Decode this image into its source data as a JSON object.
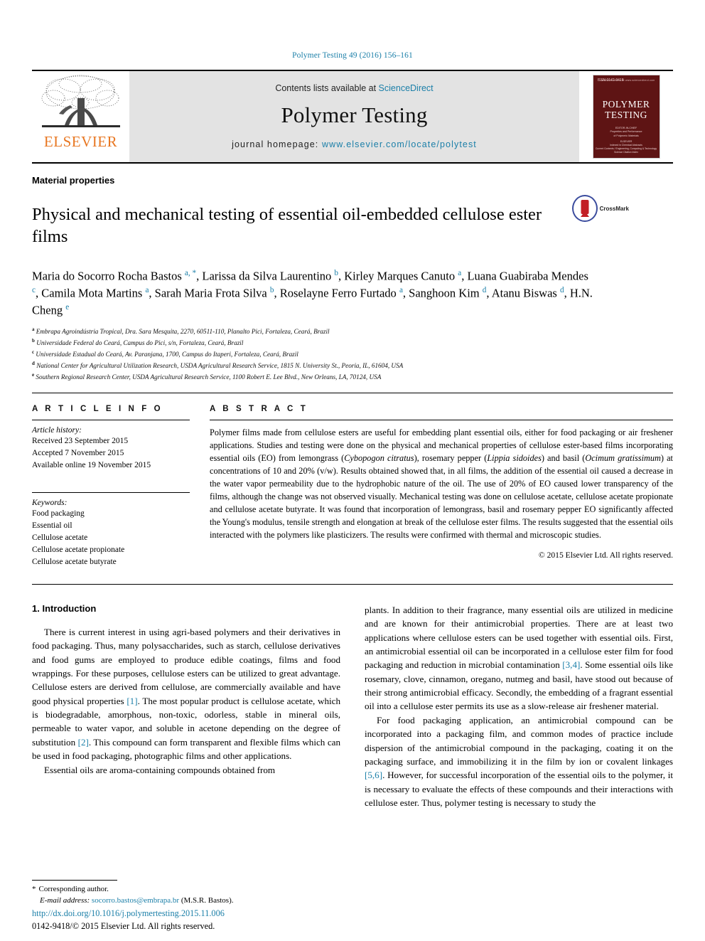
{
  "running_head": "Polymer Testing 49 (2016) 156–161",
  "masthead": {
    "publisher_name": "ELSEVIER",
    "contents_prefix": "Contents lists available at ",
    "contents_link": "ScienceDirect",
    "journal_title": "Polymer Testing",
    "homepage_prefix": "journal homepage: ",
    "homepage_link": "www.elsevier.com/locate/polytest",
    "cover": {
      "top_label": "ISSN 0142-9418",
      "corner_label": "Available online at www.sciencedirect.com",
      "title_line1": "POLYMER",
      "title_line2": "TESTING",
      "sub_lines": "EDITOR-IN-CHIEF\nProperties and Performance\nof Polymeric Materials",
      "foot_lines": "ELSEVIER\nIndexed in Chemical Abstracts\nCurrent Contents / Engineering, Computing & Technology\nScience Citation Index"
    }
  },
  "article": {
    "section_label": "Material properties",
    "title": "Physical and mechanical testing of essential oil-embedded cellulose ester films",
    "crossmark_label": "CrossMark",
    "authors_html": "Maria do Socorro Rocha Bastos <sup class=\"sup-mark\">a, *</sup>, Larissa da Silva Laurentino <sup class=\"sup-mark\">b</sup>, Kirley Marques Canuto <sup class=\"sup-mark\">a</sup>, Luana Guabiraba Mendes <sup class=\"sup-mark\">c</sup>, Camila Mota Martins <sup class=\"sup-mark\">a</sup>, Sarah Maria Frota Silva <sup class=\"sup-mark\">b</sup>, Roselayne Ferro Furtado <sup class=\"sup-mark\">a</sup>, Sanghoon Kim <sup class=\"sup-mark\">d</sup>, Atanu Biswas <sup class=\"sup-mark\">d</sup>, H.N. Cheng <sup class=\"sup-mark\">e</sup>",
    "affiliations": [
      {
        "mark": "a",
        "text": "Embrapa Agroindústria Tropical, Dra. Sara Mesquita, 2270, 60511-110, Planalto Pici, Fortaleza, Ceará, Brazil"
      },
      {
        "mark": "b",
        "text": "Universidade Federal do Ceará, Campus do Pici, s/n, Fortaleza, Ceará, Brazil"
      },
      {
        "mark": "c",
        "text": "Universidade Estadual do Ceará, Av. Paranjana, 1700, Campus do Itaperi, Fortaleza, Ceará, Brazil"
      },
      {
        "mark": "d",
        "text": "National Center for Agricultural Utilization Research, USDA Agricultural Research Service, 1815 N. University St., Peoria, IL, 61604, USA"
      },
      {
        "mark": "e",
        "text": "Southern Regional Research Center, USDA Agricultural Research Service, 1100 Robert E. Lee Blvd., New Orleans, LA, 70124, USA"
      }
    ]
  },
  "article_info": {
    "heading": "A R T I C L E   I N F O",
    "history_label": "Article history:",
    "history": [
      "Received 23 September 2015",
      "Accepted 7 November 2015",
      "Available online 19 November 2015"
    ],
    "keywords_label": "Keywords:",
    "keywords": [
      "Food packaging",
      "Essential oil",
      "Cellulose acetate",
      "Cellulose acetate propionate",
      "Cellulose acetate butyrate"
    ]
  },
  "abstract": {
    "heading": "A B S T R A C T",
    "body_html": "Polymer films made from cellulose esters are useful for embedding plant essential oils, either for food packaging or air freshener applications. Studies and testing were done on the physical and mechanical properties of cellulose ester-based films incorporating essential oils (EO) from lemongrass (<i>Cybopogon citratus</i>), rosemary pepper (<i>Lippia sidoides</i>) and basil (<i>Ocimum gratissimum</i>) at concentrations of 10 and 20% (v/w). Results obtained showed that, in all films, the addition of the essential oil caused a decrease in the water vapor permeability due to the hydrophobic nature of the oil. The use of 20% of EO caused lower transparency of the films, although the change was not observed visually. Mechanical testing was done on cellulose acetate, cellulose acetate propionate and cellulose acetate butyrate. It was found that incorporation of lemongrass, basil and rosemary pepper EO significantly affected the Young's modulus, tensile strength and elongation at break of the cellulose ester films. The results suggested that the essential oils interacted with the polymers like plasticizers. The results were confirmed with thermal and microscopic studies.",
    "copyright": "© 2015 Elsevier Ltd. All rights reserved."
  },
  "introduction": {
    "heading": "1. Introduction",
    "left_paragraphs_html": [
      "There is current interest in using agri-based polymers and their derivatives in food packaging. Thus, many polysaccharides, such as starch, cellulose derivatives and food gums are employed to produce edible coatings, films and food wrappings. For these purposes, cellulose esters can be utilized to great advantage. Cellulose esters are derived from cellulose, are commercially available and have good physical properties <span class=\"ref\">[1]</span>. The most popular product is cellulose acetate, which is biodegradable, amorphous, non-toxic, odorless, stable in mineral oils, permeable to water vapor, and soluble in acetone depending on the degree of substitution <span class=\"ref\">[2]</span>. This compound can form transparent and flexible films which can be used in food packaging, photographic films and other applications.",
      "Essential oils are aroma-containing compounds obtained from"
    ],
    "right_paragraphs_html": [
      "plants. In addition to their fragrance, many essential oils are utilized in medicine and are known for their antimicrobial properties. There are at least two applications where cellulose esters can be used together with essential oils. First, an antimicrobial essential oil can be incorporated in a cellulose ester film for food packaging and reduction in microbial contamination <span class=\"ref\">[3,4]</span>. Some essential oils like rosemary, clove, cinnamon, oregano, nutmeg and basil, have stood out because of their strong antimicrobial efficacy. Secondly, the embedding of a fragrant essential oil into a cellulose ester permits its use as a slow-release air freshener material.",
      "For food packaging application, an antimicrobial compound can be incorporated into a packaging film, and common modes of practice include dispersion of the antimicrobial compound in the packaging, coating it on the packaging surface, and immobilizing it in the film by ion or covalent linkages <span class=\"ref\">[5,6]</span>. However, for successful incorporation of the essential oils to the polymer, it is necessary to evaluate the effects of these compounds and their interactions with cellulose ester. Thus, polymer testing is necessary to study the"
    ]
  },
  "footer": {
    "corresponding_star": "*",
    "corresponding_label": "Corresponding author.",
    "email_label": "E-mail address:",
    "email": "socorro.bastos@embrapa.br",
    "email_owner": "(M.S.R. Bastos).",
    "doi": "http://dx.doi.org/10.1016/j.polymertesting.2015.11.006",
    "issn_line": "0142-9418/© 2015 Elsevier Ltd. All rights reserved."
  }
}
